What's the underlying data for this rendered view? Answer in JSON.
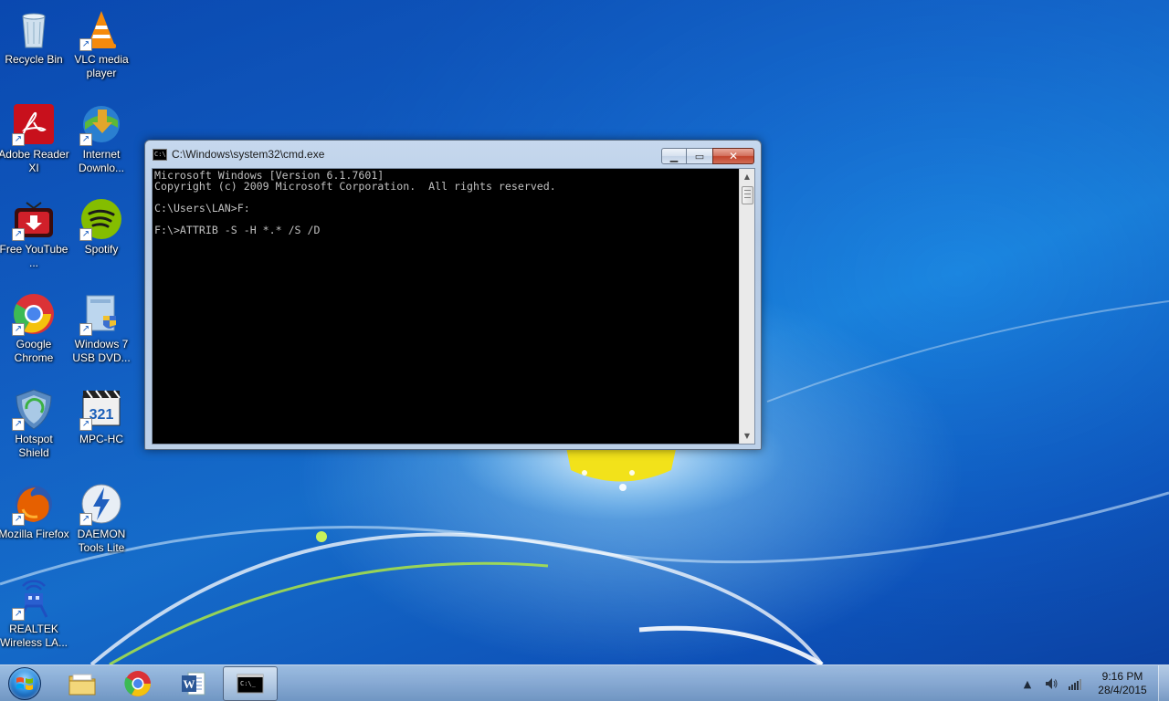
{
  "desktop": {
    "icons": [
      {
        "label": "Recycle Bin",
        "icon": "recycle-bin-icon",
        "shortcut": false
      },
      {
        "label": "VLC media player",
        "icon": "vlc-icon",
        "shortcut": true
      },
      {
        "label": "Adobe Reader XI",
        "icon": "adobe-reader-icon",
        "shortcut": true
      },
      {
        "label": "Internet Downlo...",
        "icon": "internet-download-manager-icon",
        "shortcut": true
      },
      {
        "label": "Free YouTube ...",
        "icon": "free-youtube-downloader-icon",
        "shortcut": true
      },
      {
        "label": "Spotify",
        "icon": "spotify-icon",
        "shortcut": true
      },
      {
        "label": "Google Chrome",
        "icon": "chrome-icon",
        "shortcut": true
      },
      {
        "label": "Windows 7 USB DVD...",
        "icon": "windows7-usb-dvd-tool-icon",
        "shortcut": true
      },
      {
        "label": "Hotspot Shield",
        "icon": "hotspot-shield-icon",
        "shortcut": true
      },
      {
        "label": "MPC-HC",
        "icon": "mpc-hc-icon",
        "shortcut": true
      },
      {
        "label": "Mozilla Firefox",
        "icon": "firefox-icon",
        "shortcut": true
      },
      {
        "label": "DAEMON Tools Lite",
        "icon": "daemon-tools-icon",
        "shortcut": true
      },
      {
        "label": "REALTEK Wireless LA...",
        "icon": "realtek-wireless-icon",
        "shortcut": true
      }
    ]
  },
  "cmd_window": {
    "title": "C:\\Windows\\system32\\cmd.exe",
    "app_icon_text": "C:\\",
    "buttons": {
      "minimize": "▁",
      "maximize": "▭",
      "close": "✕"
    },
    "lines": [
      "Microsoft Windows [Version 6.1.7601]",
      "Copyright (c) 2009 Microsoft Corporation.  All rights reserved.",
      "",
      "C:\\Users\\LAN>F:",
      "",
      "F:\\>ATTRIB -S -H *.* /S /D"
    ]
  },
  "taskbar": {
    "start": "start-button",
    "pinned": [
      {
        "name": "explorer",
        "icon": "folder-icon",
        "active": false
      },
      {
        "name": "chrome",
        "icon": "chrome-icon",
        "active": false
      },
      {
        "name": "word",
        "icon": "word-icon",
        "active": false
      },
      {
        "name": "cmd",
        "icon": "cmd-icon",
        "active": true
      }
    ],
    "tray": {
      "show_hidden": "▲",
      "time": "9:16 PM",
      "date": "28/4/2015"
    }
  }
}
